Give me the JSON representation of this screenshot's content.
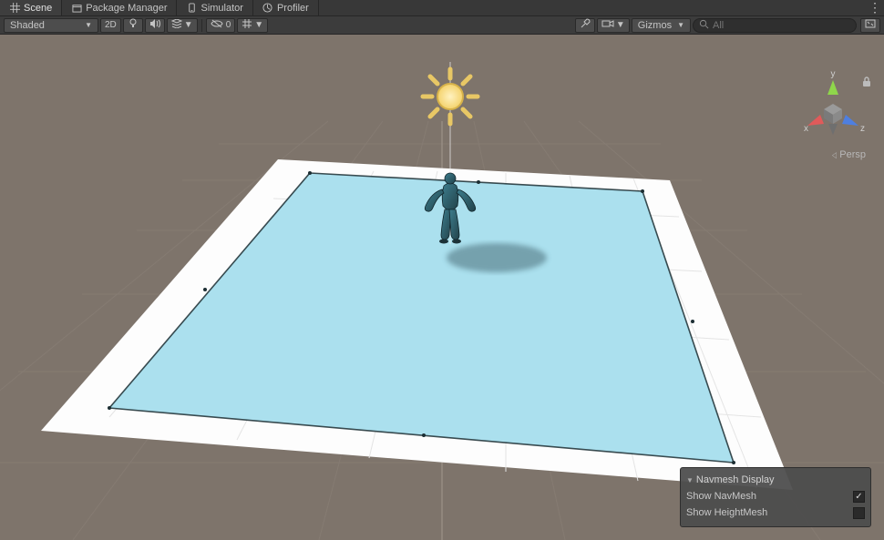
{
  "tabs": {
    "scene": "Scene",
    "package_manager": "Package Manager",
    "simulator": "Simulator",
    "profiler": "Profiler"
  },
  "toolbar": {
    "draw_mode": "Shaded",
    "mode_2d": "2D",
    "eye_count": "0",
    "gizmos": "Gizmos",
    "search_placeholder": "All"
  },
  "orientation": {
    "x": "x",
    "y": "y",
    "z": "z",
    "projection": "Persp"
  },
  "panel": {
    "title": "Navmesh Display",
    "show_navmesh": "Show NavMesh",
    "show_heightmesh": "Show HeightMesh",
    "show_navmesh_checked": true,
    "show_heightmesh_checked": false
  },
  "icons": {
    "scene": "scene-grid-icon",
    "package": "package-icon",
    "simulator": "simulator-icon",
    "profiler": "profiler-icon",
    "light": "lightbulb-icon",
    "audio": "audio-icon",
    "fx": "fx-stack-icon",
    "eye": "visibility-icon",
    "grid": "grid-snap-icon",
    "tools": "tools-icon",
    "camera": "camera-icon",
    "search": "search-icon",
    "expand": "expand-icon",
    "lock": "padlock-icon",
    "kebab": "more-icon"
  }
}
